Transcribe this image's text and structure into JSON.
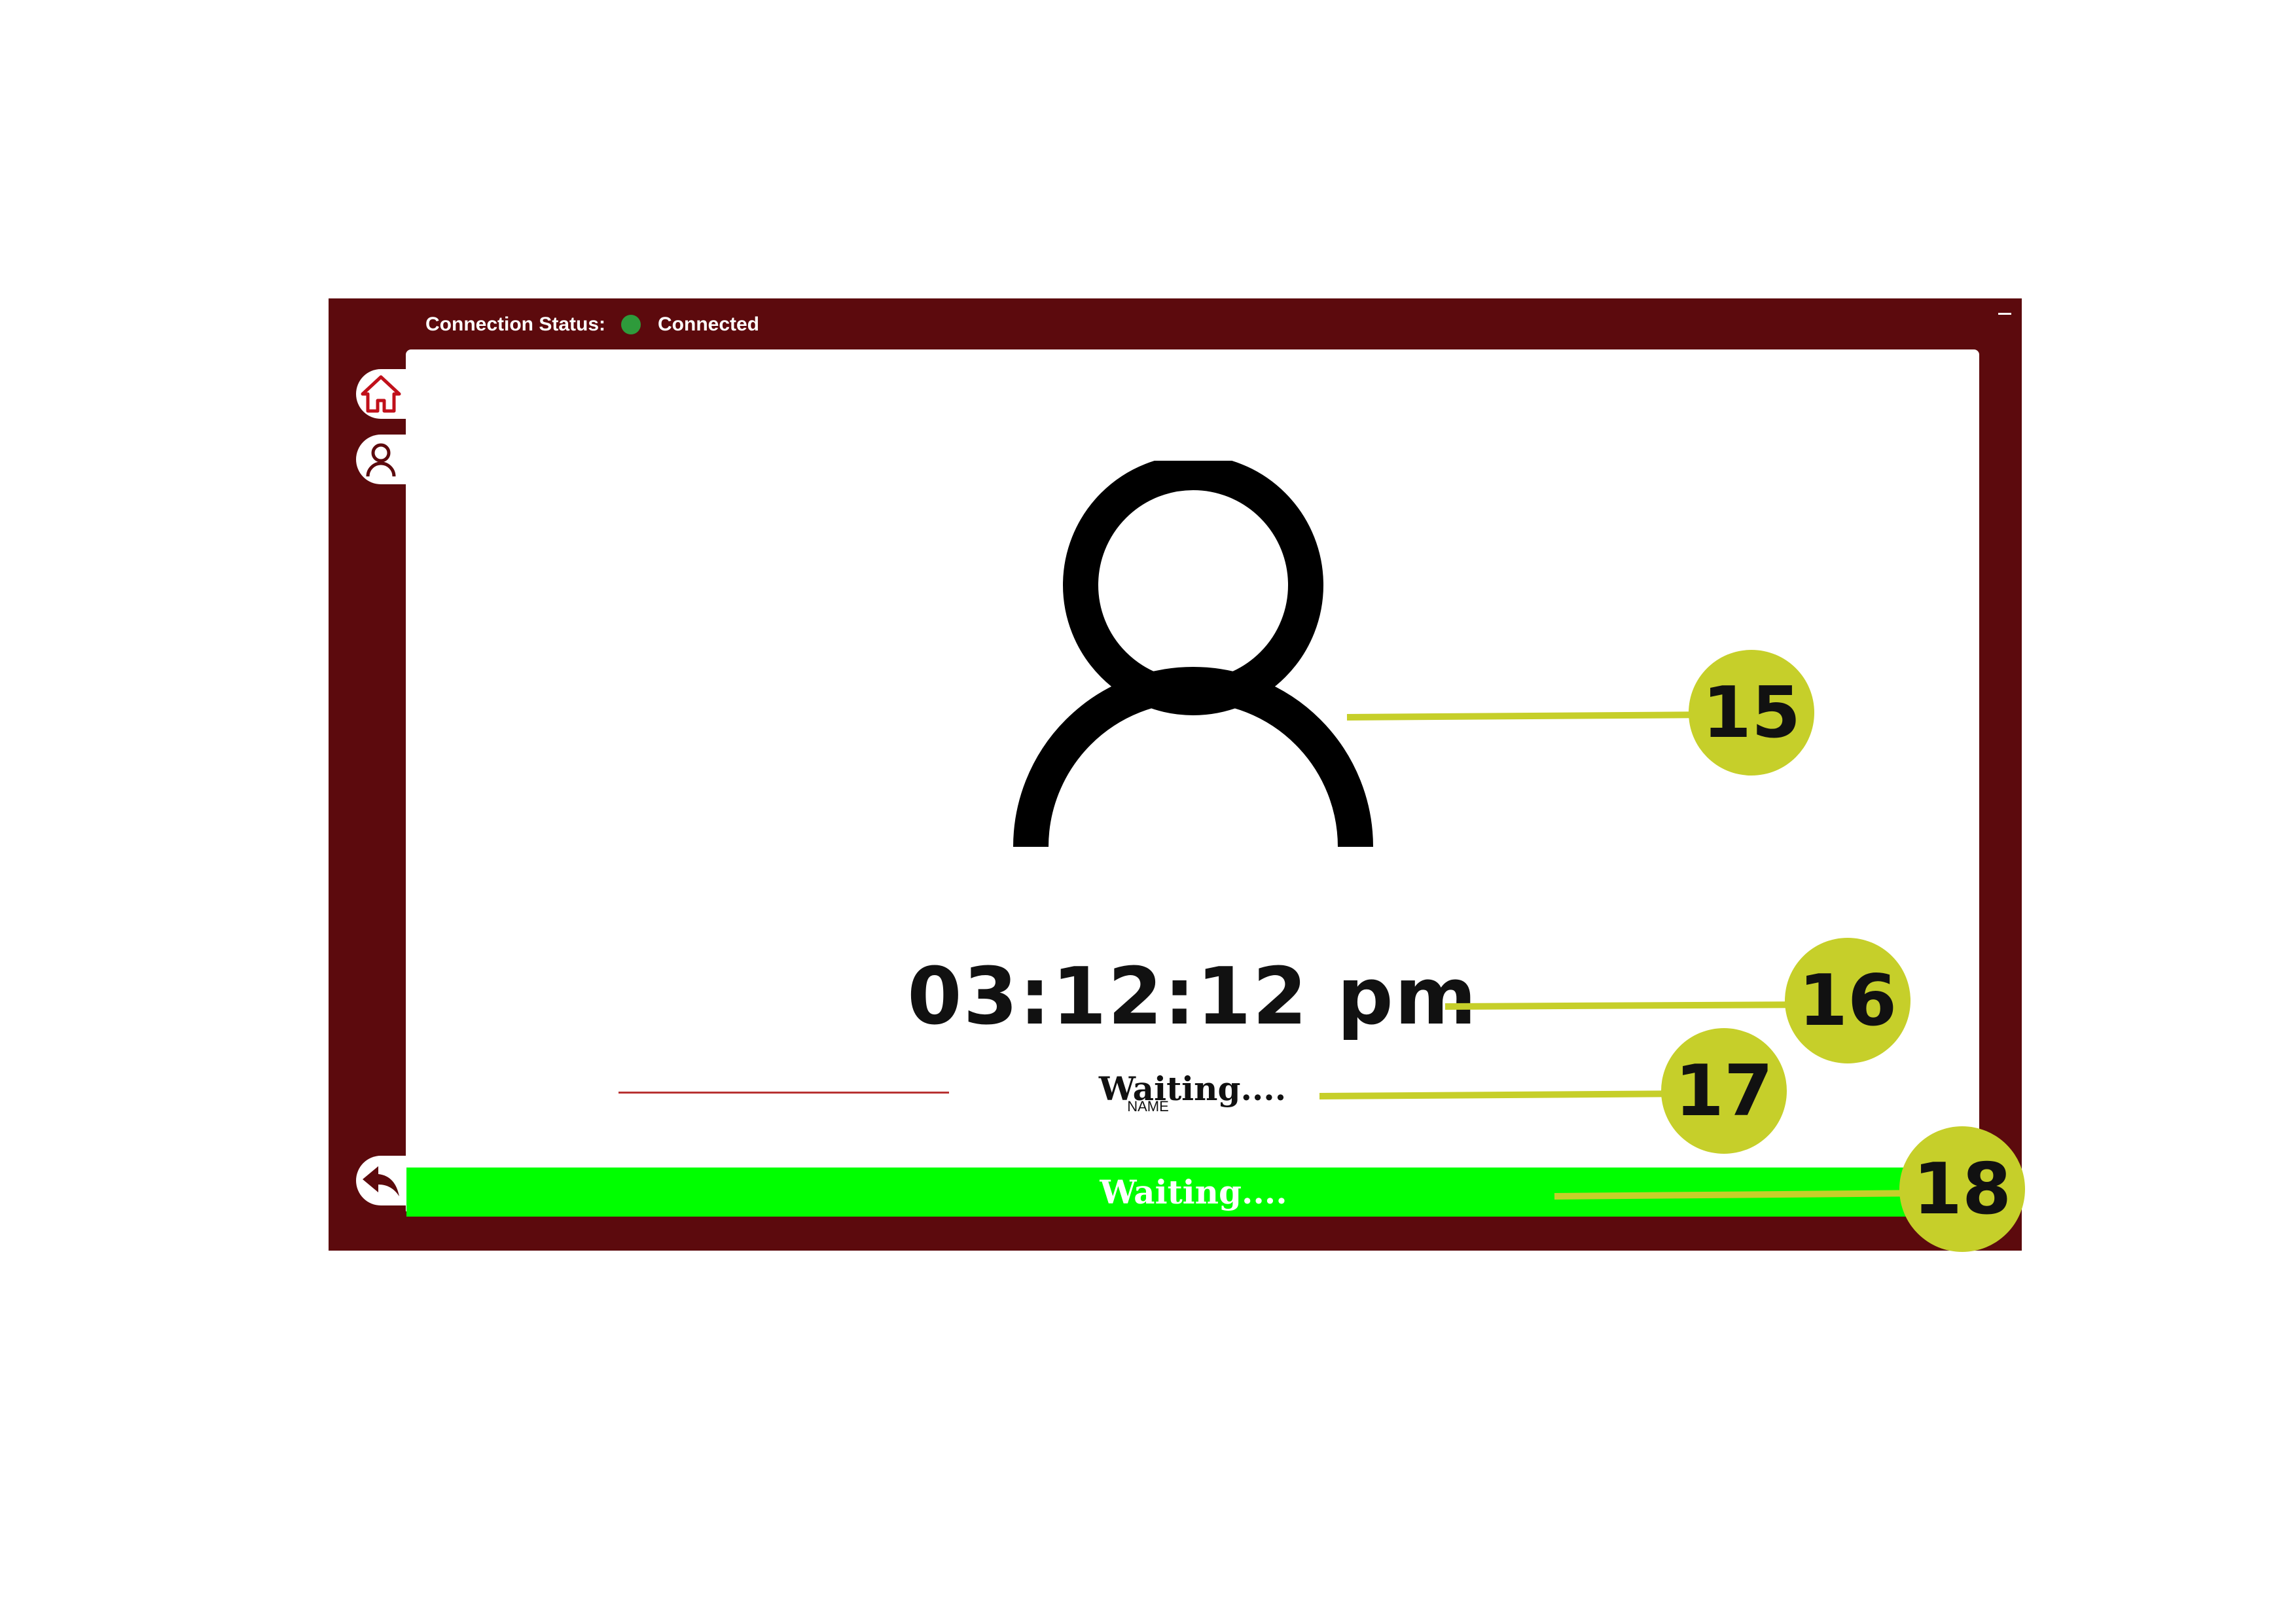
{
  "header": {
    "connection_label": "Connection Status:",
    "connection_value": "Connected",
    "status_color": "#2e9b3b"
  },
  "sidebar": {
    "items": [
      {
        "icon": "home-icon"
      },
      {
        "icon": "user-icon"
      },
      {
        "icon": "back-arrow-icon"
      }
    ]
  },
  "main": {
    "avatar_icon": "user-icon",
    "clock": "03:12:12 pm",
    "status_text": "Waiting....",
    "name_caption": "NAME",
    "status_bar_text": "Waiting....",
    "status_bar_color": "#00ff00"
  },
  "callouts": [
    "15",
    "16",
    "17",
    "18"
  ],
  "colors": {
    "frame": "#5c0a0d",
    "callout": "#c6cf2a"
  }
}
